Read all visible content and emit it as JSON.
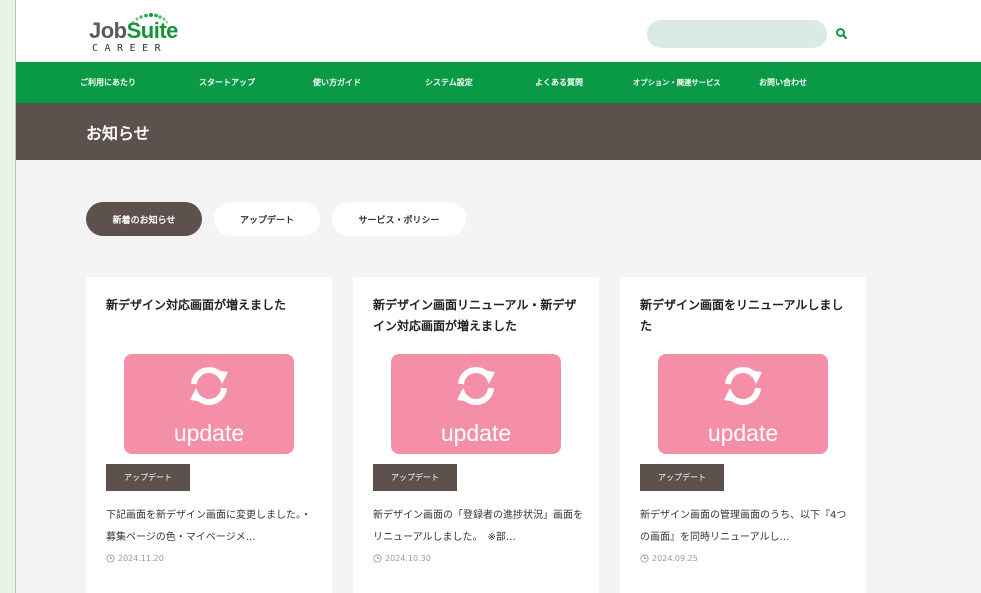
{
  "header": {
    "logo": {
      "brand_a": "Job",
      "brand_b": "Suite",
      "sub": "CAREER"
    },
    "search": {
      "value": "",
      "placeholder": ""
    },
    "search_icon": "search-icon"
  },
  "nav": {
    "items": [
      {
        "label": "ご利用にあたり"
      },
      {
        "label": "スタートアップ"
      },
      {
        "label": "使い方ガイド"
      },
      {
        "label": "システム設定"
      },
      {
        "label": "よくある質問"
      },
      {
        "label": "オプション・関連サービス"
      },
      {
        "label": "お問い合わせ"
      }
    ]
  },
  "page": {
    "title": "お知らせ"
  },
  "tabs": [
    {
      "label": "新着のお知らせ",
      "active": true
    },
    {
      "label": "アップデート",
      "active": false
    },
    {
      "label": "サービス・ポリシー",
      "active": false
    }
  ],
  "cards": [
    {
      "title": "新デザイン対応画面が増えました",
      "thumb_label": "update",
      "category": "アップデート",
      "excerpt": "下記画面を新デザイン画面に変更しました。・募集ページの色・マイページメ…",
      "date": "2024.11.20"
    },
    {
      "title": "新デザイン画面リニューアル・新デザイン対応画面が増えました",
      "thumb_label": "update",
      "category": "アップデート",
      "excerpt": "新デザイン画面の「登録者の進捗状況」画面をリニューアルしました。　※部…",
      "date": "2024.10.30"
    },
    {
      "title": "新デザイン画面をリニューアルしました",
      "thumb_label": "update",
      "category": "アップデート",
      "excerpt": "新デザイン画面の管理画面のうち、以下『4つの画面』を同時リニューアルし…",
      "date": "2024.09.25"
    }
  ],
  "colors": {
    "brand_green": "#0a9a46",
    "title_bar": "#5c514d",
    "thumb_pink": "#f58fa8"
  }
}
